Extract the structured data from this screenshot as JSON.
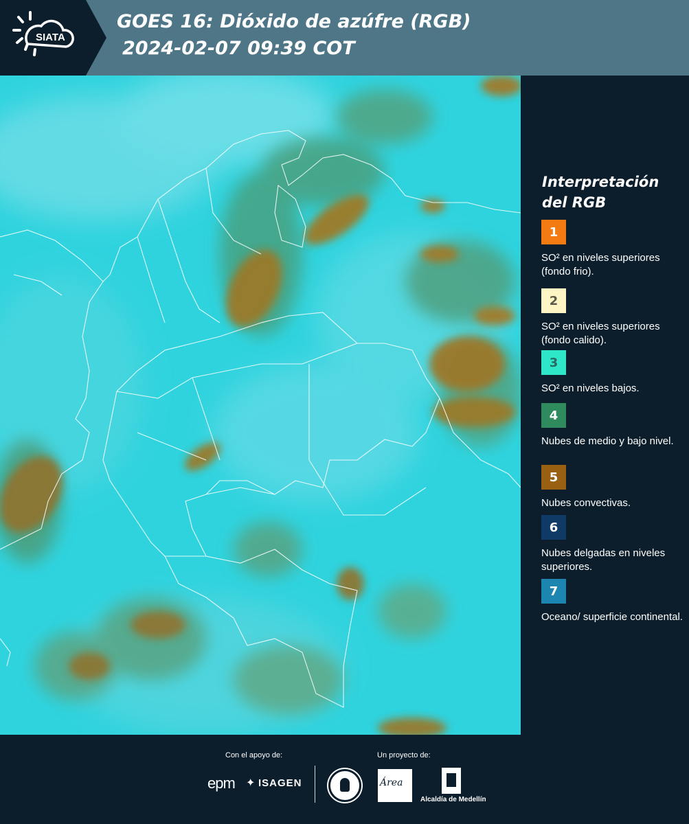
{
  "header": {
    "logo_text": "SIATA",
    "title_line1": "GOES 16: Dióxido de azúfre (RGB)",
    "title_line2": "2024-02-07 09:39 COT"
  },
  "legend": {
    "title_line1": "Interpretación",
    "title_line2": "del RGB",
    "items": [
      {
        "number": "1",
        "color": "#f47a12",
        "label": "SO² en niveles superiores (fondo frio)."
      },
      {
        "number": "2",
        "color": "#fdf6c4",
        "label": "SO² en niveles superiores (fondo calido)."
      },
      {
        "number": "3",
        "color": "#2ee6c8",
        "label": "SO² en niveles bajos."
      },
      {
        "number": "4",
        "color": "#2f8a5e",
        "label": "Nubes de medio y bajo nivel."
      },
      {
        "number": "5",
        "color": "#9a6012",
        "label": "Nubes convectivas."
      },
      {
        "number": "6",
        "color": "#0f3a66",
        "label": "Nubes delgadas en niveles superiores."
      },
      {
        "number": "7",
        "color": "#1c86b0",
        "label": "Oceano/ superficie continental."
      }
    ]
  },
  "footer": {
    "support_label": "Con el apoyo de:",
    "project_label": "Un proyecto de:",
    "sponsor1": "epm",
    "sponsor2": "ISAGEN",
    "area_logo_text": "Área",
    "alcaldia": "Alcaldía de Medellín"
  },
  "colors": {
    "header_bg": "#4e7687",
    "panel_bg": "#0c1e2c",
    "map_cyan": "#2fd3de",
    "cloud_brown": "#9a7a2a",
    "cloud_green": "#4c9c78"
  }
}
